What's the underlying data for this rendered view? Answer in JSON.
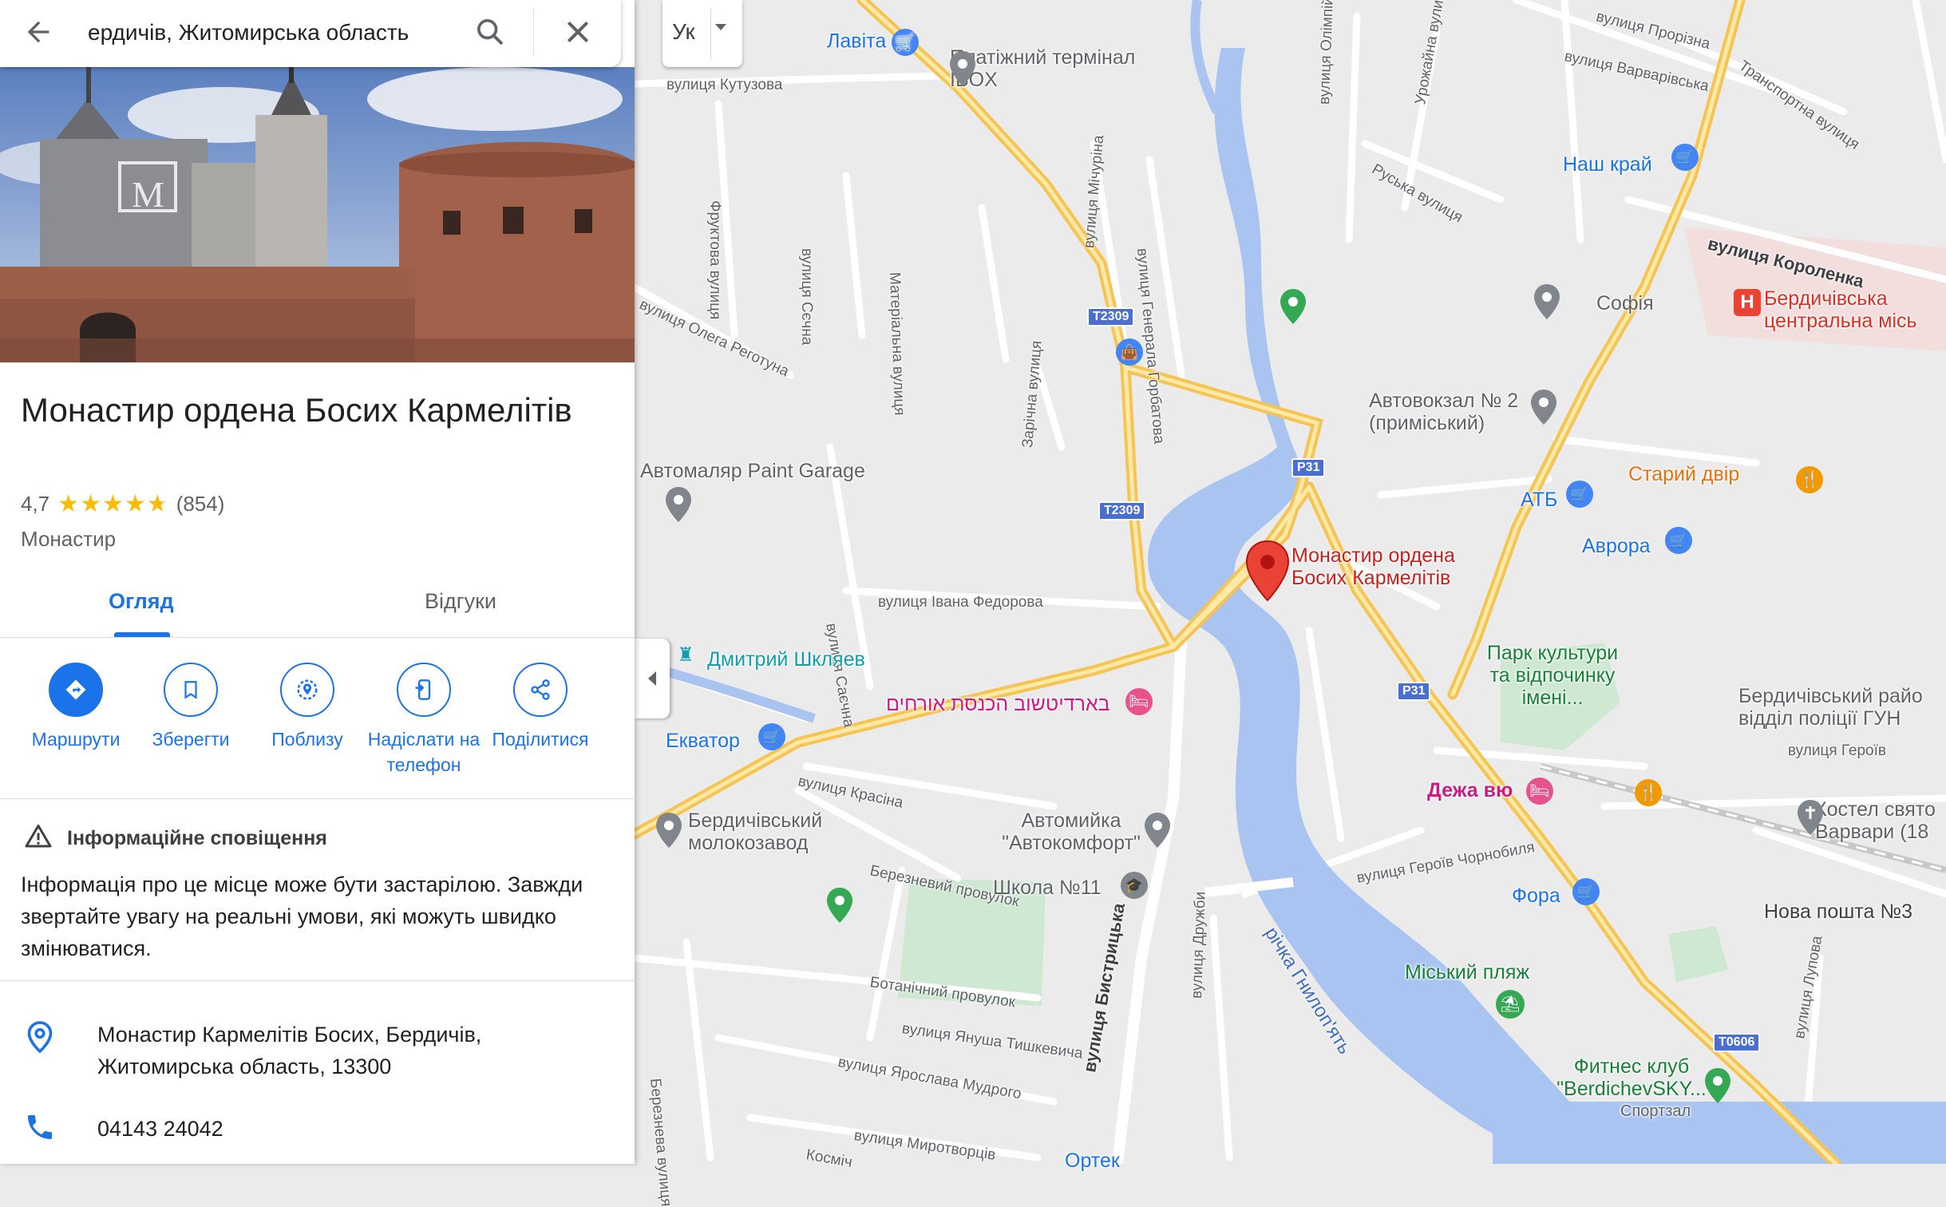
{
  "search": {
    "query": "ердичів, Житомирська область"
  },
  "place": {
    "title": "Монастир ордена Босих Кармелітів",
    "rating": "4,7",
    "stars": 4.7,
    "reviews": "(854)",
    "category": "Монастир",
    "address": "Монастир Кармелітів Босих, Бердичів, Житомирська область, 13300",
    "phone": "04143 24042"
  },
  "tabs": [
    {
      "label": "Огляд",
      "active": true
    },
    {
      "label": "Відгуки",
      "active": false
    }
  ],
  "actions": [
    {
      "label": "Маршрути",
      "icon": "directions-icon"
    },
    {
      "label": "Зберегти",
      "icon": "bookmark-icon"
    },
    {
      "label": "Поблизу",
      "icon": "nearby-icon"
    },
    {
      "label": "Надіслати на телефон",
      "icon": "send-to-phone-icon"
    },
    {
      "label": "Поділитися",
      "icon": "share-icon"
    }
  ],
  "notice": {
    "heading": "Інформаційне сповіщення",
    "body": "Інформація про це місце може бути застарілою. Завжди звертайте увагу на реальні умови, які можуть швидко змінюватися."
  },
  "language_button": {
    "label": "Ук"
  },
  "map": {
    "selected_place": "Монастир ордена Босих Кармелітів",
    "pois": [
      {
        "name": "Лавіта",
        "color": "#1a73e8"
      },
      {
        "name": "Платіжний термінал IBOX",
        "color": "#5f6368"
      },
      {
        "name": "Наш край",
        "color": "#1a73e8"
      },
      {
        "name": "Софія",
        "color": "#5f6368"
      },
      {
        "name": "Бердичівська центральна місь",
        "color": "#d93025"
      },
      {
        "name": "Автовокзал № 2 (приміський)",
        "color": "#5f6368"
      },
      {
        "name": "Старий двір",
        "color": "#e8710a"
      },
      {
        "name": "АТБ",
        "color": "#1a73e8"
      },
      {
        "name": "Аврора",
        "color": "#1a73e8"
      },
      {
        "name": "Автомаляр Paint Garage",
        "color": "#5f6368"
      },
      {
        "name": "Дмитрий Шкляев",
        "color": "#129eaf"
      },
      {
        "name": "בארדיטשוב הכנסת אורחים",
        "color": "#d01884"
      },
      {
        "name": "Екватор",
        "color": "#1a73e8"
      },
      {
        "name": "Бердичівський молокозавод",
        "color": "#5f6368"
      },
      {
        "name": "Автомийка \"Автокомфорт\"",
        "color": "#5f6368"
      },
      {
        "name": "Школа №11",
        "color": "#5f6368"
      },
      {
        "name": "Парк культури та відпочинку імені...",
        "color": "#188038"
      },
      {
        "name": "Дежа вю",
        "color": "#d01884"
      },
      {
        "name": "Фора",
        "color": "#1a73e8"
      },
      {
        "name": "Міський пляж",
        "color": "#188038"
      },
      {
        "name": "Фитнес клуб \"BerdichevSKY...",
        "color": "#188038"
      },
      {
        "name": "Спортзал",
        "color": "#5f6368"
      },
      {
        "name": "Бердичівський райо відділ поліції ГУН",
        "color": "#5f6368"
      },
      {
        "name": "Костел свято Варвари (18",
        "color": "#5f6368"
      },
      {
        "name": "Нова пошта №3",
        "color": "#3c4043"
      },
      {
        "name": "Ортек",
        "color": "#1a73e8"
      }
    ],
    "streets": [
      "вулиця Кутузова",
      "Фруктова вулиця",
      "вулиця Сєчна",
      "Матеріальна вулиця",
      "вулиця Мічуріна",
      "вулиця Генерала Горбатова",
      "вулиця Олега Реготуна",
      "Зарічна вулиця",
      "вулиця Саєчна",
      "вулиця Івана Федорова",
      "вулиця Красіна",
      "Березневий провулок",
      "Ботанічний провулок",
      "вулиця Януша Тишкевича",
      "вулиця Ярослава Мудрого",
      "вулиця Миротворців",
      "вулиця Бистрицька",
      "вулиця Дружби",
      "річка Гнилоп'ять",
      "вулиця Героїв Чорнобиля",
      "вулиця Лупова",
      "вулиця Короленка",
      "вулиця Варварівська",
      "Руська вулиця",
      "Урожайна вулиця",
      "вулиця Олімпійська",
      "вулиця Прорізна",
      "Транспортна вулиця",
      "вулиця Героїв",
      "Березнева вулиця",
      "Косміч"
    ],
    "shields": [
      "T2309",
      "T2309",
      "P31",
      "P31",
      "T0606"
    ]
  }
}
